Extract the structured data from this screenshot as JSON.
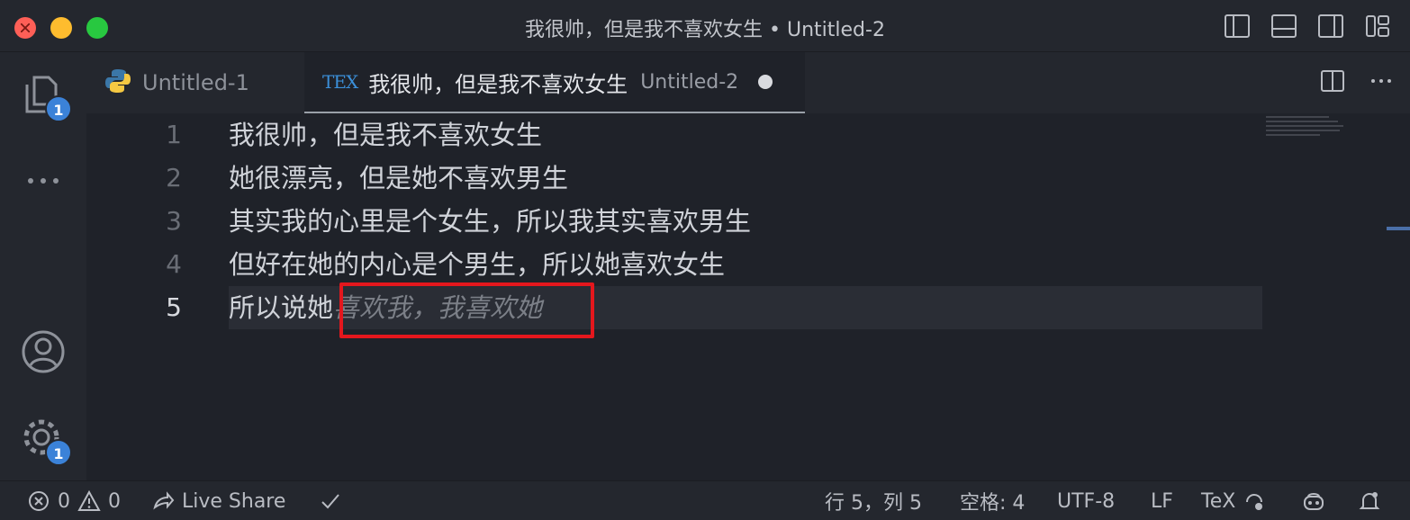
{
  "window": {
    "title": "我很帅，但是我不喜欢女生 • Untitled-2"
  },
  "activity": {
    "explorer_badge": "1",
    "settings_badge": "1"
  },
  "tabs": [
    {
      "label": "Untitled-1",
      "icon": "python-icon"
    },
    {
      "label": "我很帅，但是我不喜欢女生",
      "description": "Untitled-2",
      "icon": "tex-icon",
      "icon_text": "TEX"
    }
  ],
  "editor": {
    "lines": [
      {
        "number": "1",
        "text": "我很帅，但是我不喜欢女生"
      },
      {
        "number": "2",
        "text": "她很漂亮，但是她不喜欢男生"
      },
      {
        "number": "3",
        "text": "其实我的心里是个女生，所以我其实喜欢男生"
      },
      {
        "number": "4",
        "text": "但好在她的内心是个男生，所以她喜欢女生"
      },
      {
        "number": "5",
        "text": "所以说她",
        "suggestion": "喜欢我，我喜欢她"
      }
    ],
    "active_line": 5
  },
  "status": {
    "errors": "0",
    "warnings": "0",
    "live_share": "Live Share",
    "cursor": "行 5，列 5",
    "indent": "空格: 4",
    "encoding": "UTF-8",
    "eol": "LF",
    "language": "TeX"
  },
  "colors": {
    "accent": "#3b82d8",
    "highlight": "#e4171d"
  }
}
